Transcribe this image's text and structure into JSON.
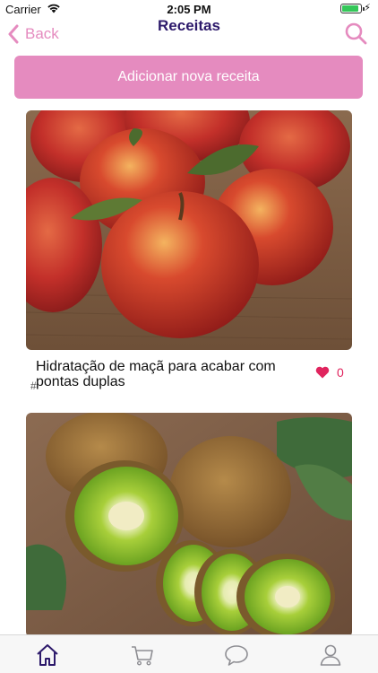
{
  "status_bar": {
    "carrier": "Carrier",
    "time": "2:05 PM",
    "battery_level": 0.9
  },
  "nav": {
    "back_label": "Back",
    "title": "Receitas",
    "accent_color": "#e58bbf",
    "title_color": "#2d1a6b"
  },
  "add_button": {
    "label": "Adicionar nova receita"
  },
  "recipes": [
    {
      "title": "Hidratação de maçã para acabar com pontas duplas",
      "tag_symbol": "#",
      "likes": "0",
      "image_icon": "apples-photo"
    },
    {
      "title": "",
      "image_icon": "kiwi-photo"
    }
  ],
  "tab_bar": {
    "items": [
      {
        "icon": "home-icon",
        "active": true
      },
      {
        "icon": "cart-icon",
        "active": false
      },
      {
        "icon": "chat-icon",
        "active": false
      },
      {
        "icon": "profile-icon",
        "active": false
      }
    ],
    "active_color": "#2d1a6b",
    "inactive_color": "#8e8e93"
  }
}
